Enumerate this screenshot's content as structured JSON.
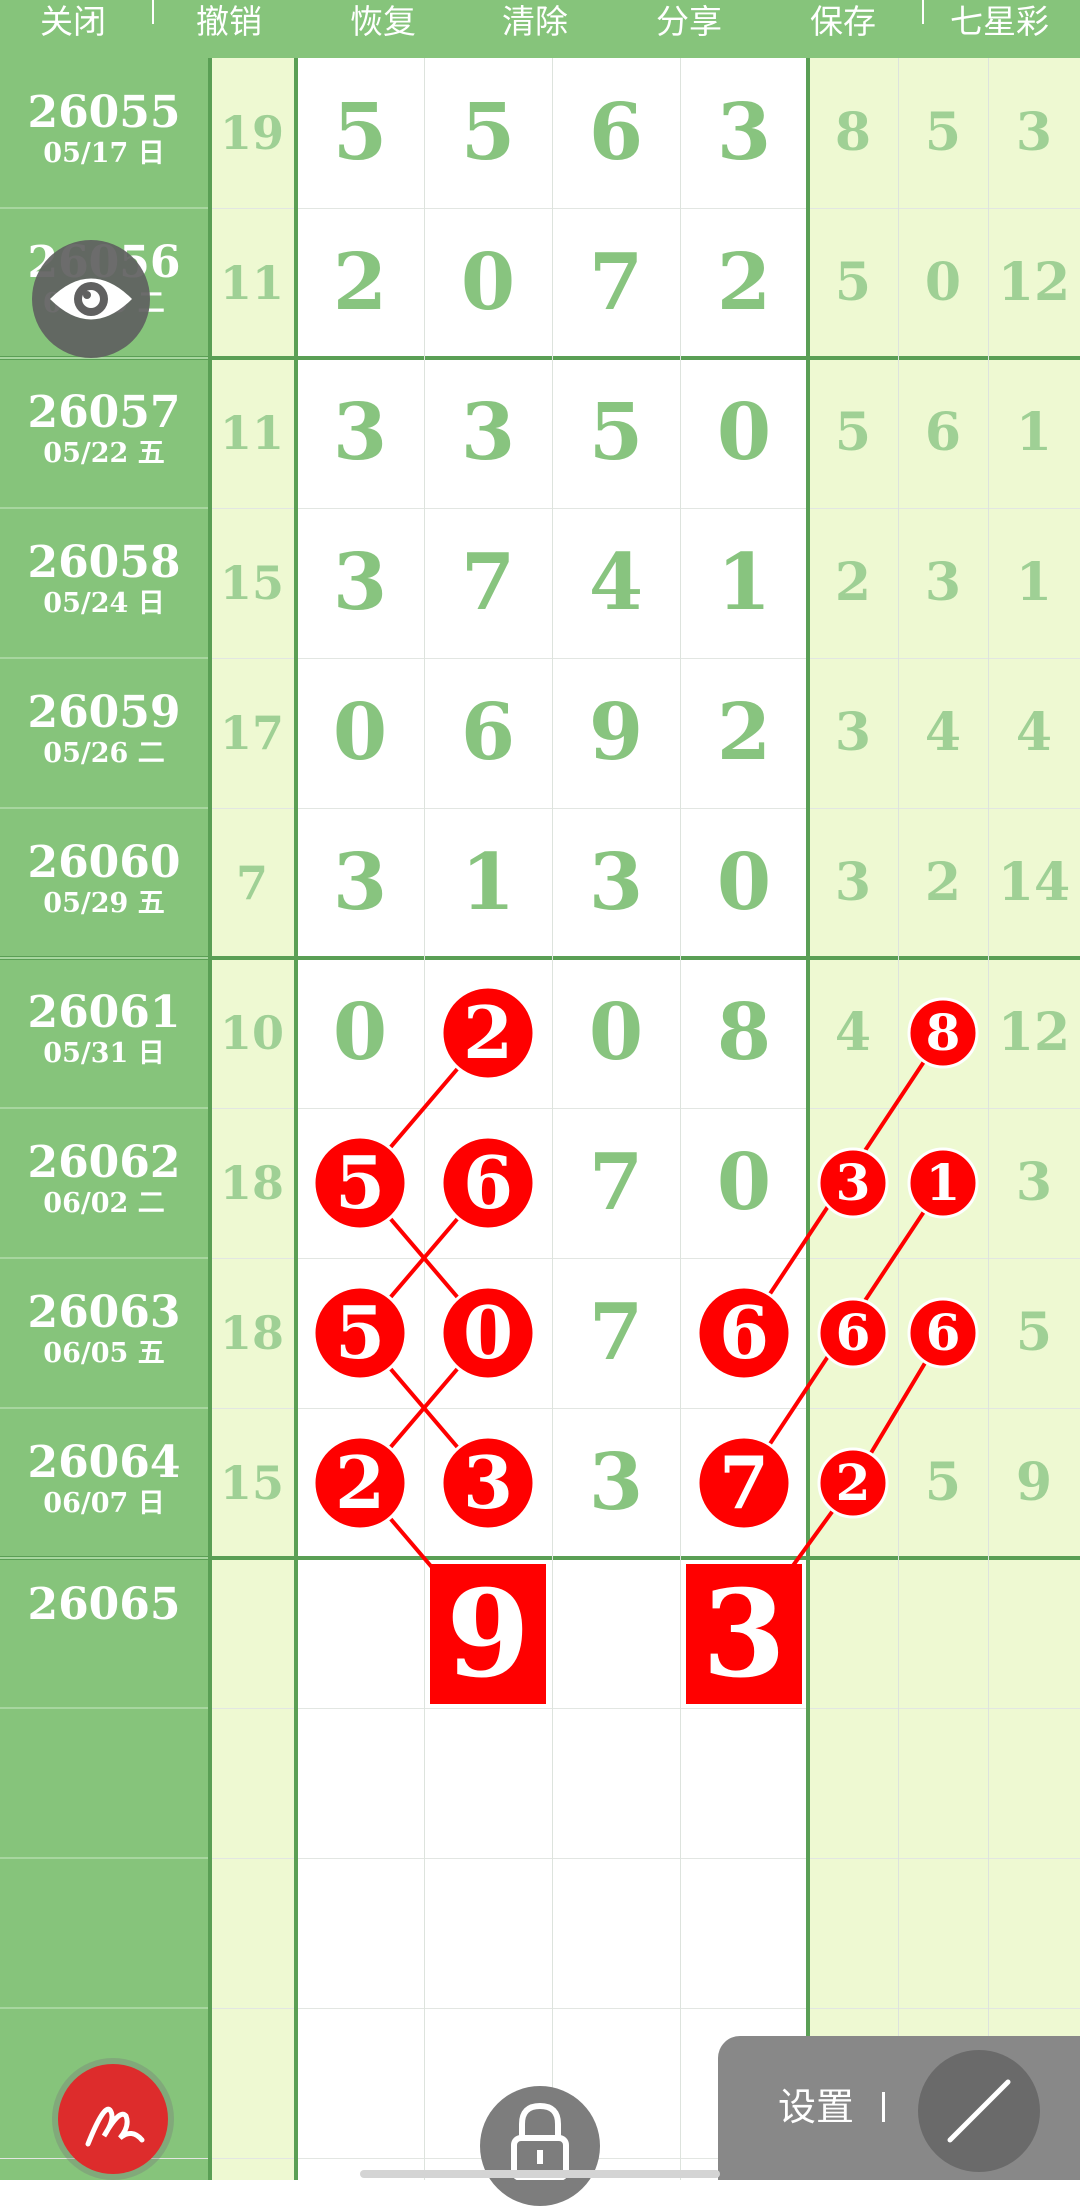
{
  "toolbar": {
    "close": "关闭",
    "undo": "撤销",
    "redo": "恢复",
    "clear": "清除",
    "share": "分享",
    "save": "保存",
    "lottery": "七星彩"
  },
  "rows": [
    {
      "issue": "26055",
      "date": "05/17 日",
      "sum": "19",
      "main": [
        "5",
        "5",
        "6",
        "3"
      ],
      "tail": [
        "8",
        "5",
        "3"
      ]
    },
    {
      "issue": "26056",
      "date": "05/19 二",
      "sum": "11",
      "main": [
        "2",
        "0",
        "7",
        "2"
      ],
      "tail": [
        "5",
        "0",
        "12"
      ]
    },
    {
      "issue": "26057",
      "date": "05/22 五",
      "sum": "11",
      "main": [
        "3",
        "3",
        "5",
        "0"
      ],
      "tail": [
        "5",
        "6",
        "1"
      ]
    },
    {
      "issue": "26058",
      "date": "05/24 日",
      "sum": "15",
      "main": [
        "3",
        "7",
        "4",
        "1"
      ],
      "tail": [
        "2",
        "3",
        "1"
      ]
    },
    {
      "issue": "26059",
      "date": "05/26 二",
      "sum": "17",
      "main": [
        "0",
        "6",
        "9",
        "2"
      ],
      "tail": [
        "3",
        "4",
        "4"
      ]
    },
    {
      "issue": "26060",
      "date": "05/29 五",
      "sum": "7",
      "main": [
        "3",
        "1",
        "3",
        "0"
      ],
      "tail": [
        "3",
        "2",
        "14"
      ]
    },
    {
      "issue": "26061",
      "date": "05/31 日",
      "sum": "10",
      "main": [
        "0",
        "2",
        "0",
        "8"
      ],
      "tail": [
        "4",
        "8",
        "12"
      ]
    },
    {
      "issue": "26062",
      "date": "06/02 二",
      "sum": "18",
      "main": [
        "5",
        "6",
        "7",
        "0"
      ],
      "tail": [
        "3",
        "1",
        "3"
      ]
    },
    {
      "issue": "26063",
      "date": "06/05 五",
      "sum": "18",
      "main": [
        "5",
        "0",
        "7",
        "6"
      ],
      "tail": [
        "6",
        "6",
        "5"
      ]
    },
    {
      "issue": "26064",
      "date": "06/07 日",
      "sum": "15",
      "main": [
        "2",
        "3",
        "3",
        "7"
      ],
      "tail": [
        "2",
        "5",
        "9"
      ]
    },
    {
      "issue": "26065",
      "date": "",
      "sum": "",
      "main": [
        "",
        "",
        "",
        ""
      ],
      "tail": [
        "",
        "",
        ""
      ]
    },
    {
      "issue": "",
      "date": "",
      "sum": "",
      "main": [
        "",
        "",
        "",
        ""
      ],
      "tail": [
        "",
        "",
        ""
      ]
    },
    {
      "issue": "",
      "date": "",
      "sum": "",
      "main": [
        "",
        "",
        "",
        ""
      ],
      "tail": [
        "",
        "",
        ""
      ]
    },
    {
      "issue": "",
      "date": "",
      "sum": "",
      "main": [
        "",
        "",
        "",
        ""
      ],
      "tail": [
        "",
        "",
        ""
      ]
    }
  ],
  "circled_marks": [
    {
      "row": 6,
      "col": "m1",
      "value": "2"
    },
    {
      "row": 7,
      "col": "m0",
      "value": "5"
    },
    {
      "row": 7,
      "col": "m1",
      "value": "6"
    },
    {
      "row": 8,
      "col": "m0",
      "value": "5"
    },
    {
      "row": 8,
      "col": "m1",
      "value": "0"
    },
    {
      "row": 9,
      "col": "m0",
      "value": "2"
    },
    {
      "row": 9,
      "col": "m1",
      "value": "3"
    },
    {
      "row": 8,
      "col": "m3",
      "value": "6"
    },
    {
      "row": 9,
      "col": "m3",
      "value": "7"
    },
    {
      "row": 6,
      "col": "t1",
      "value": "8"
    },
    {
      "row": 7,
      "col": "t0",
      "value": "3"
    },
    {
      "row": 7,
      "col": "t1",
      "value": "1"
    },
    {
      "row": 8,
      "col": "t0",
      "value": "6"
    },
    {
      "row": 8,
      "col": "t1",
      "value": "6"
    },
    {
      "row": 9,
      "col": "t0",
      "value": "2"
    }
  ],
  "predictions": [
    {
      "row": 10,
      "col": "m1",
      "value": "9"
    },
    {
      "row": 10,
      "col": "m3",
      "value": "3"
    }
  ],
  "settings_label": "设置",
  "colors": {
    "issue_bg": "#86c47b",
    "sum_bg": "#eef9d2",
    "tail_bg": "#eef9d2",
    "main_bg": "#ffffff",
    "accent_red": "#ff0000",
    "grid_green": "#5a9f55"
  },
  "icons": {
    "eye": "eye-icon",
    "draw": "pen-scribble-icon",
    "lock": "lock-icon",
    "line": "diagonal-line-icon"
  }
}
